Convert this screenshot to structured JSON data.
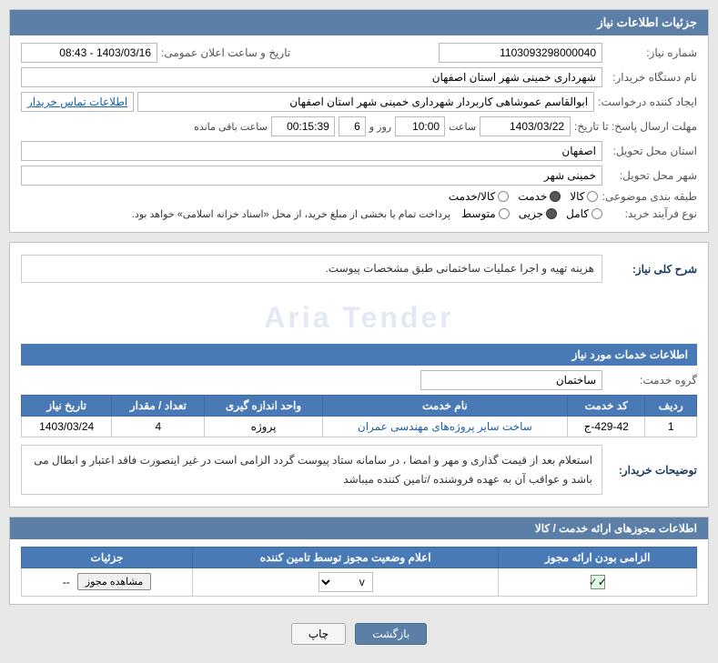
{
  "page": {
    "title": "جزئیات اطلاعات نیاز",
    "sections": {
      "main_info": {
        "header": "جزئیات اطلاعات نیاز",
        "fields": {
          "request_number_label": "شماره نیاز:",
          "request_number_value": "1103093298000040",
          "date_time_label": "تاریخ و ساعت اعلان عمومی:",
          "date_time_value": "1403/03/16 - 08:43",
          "buyer_org_label": "نام دستگاه خریدار:",
          "buyer_org_value": "شهرداری خمینی شهر استان اصفهان",
          "creator_label": "ایجاد کننده درخواست:",
          "creator_value": "ابوالقاسم عموشاهی کاربردار شهرداری خمینی شهر استان اصفهان",
          "contact_link": "اطلاعات تماس خریدار",
          "response_deadline_label": "مهلت ارسال پاسخ: تا تاریخ:",
          "response_date": "1403/03/22",
          "response_time_label": "ساعت",
          "response_time": "10:00",
          "response_day_label": "روز و",
          "response_day": "6",
          "response_remaining_label": "ساعت باقی مانده",
          "response_remaining": "00:15:39",
          "delivery_province_label": "استان محل تحویل:",
          "delivery_province_value": "اصفهان",
          "delivery_city_label": "شهر محل تحویل:",
          "delivery_city_value": "خمینی شهر",
          "category_label": "طبقه بندی موضوعی:",
          "category_goods": "کالا",
          "category_service": "خدمت",
          "category_goods_service": "کالا/خدمت",
          "category_selected": "خدمت",
          "purchase_type_label": "نوع فرآیند خرید:",
          "purchase_full": "کامل",
          "purchase_partial": "جزیی",
          "purchase_medium": "متوسط",
          "purchase_selected": "جزیی",
          "purchase_note": "پرداخت تمام یا بخشی از مبلغ خرید، از محل «اسناد خزانه اسلامی» خواهد بود."
        }
      },
      "description": {
        "header": "شرح کلی نیاز:",
        "value": "هزینه تهیه و اجرا عملیات ساختمانی طبق مشخصات پیوست.",
        "services_header": "اطلاعات خدمات مورد نیاز",
        "service_group_label": "گروه خدمت:",
        "service_group_value": "ساختمان",
        "table": {
          "columns": [
            "ردیف",
            "کد خدمت",
            "نام خدمت",
            "واحد اندازه گیری",
            "تعداد / مقدار",
            "تاریخ نیاز"
          ],
          "rows": [
            {
              "row_num": "1",
              "code": "429-42-ج",
              "name": "ساخت سایر پروژه‌های مهندسی عمران",
              "unit": "پروژه",
              "qty": "4",
              "date": "1403/03/24"
            }
          ]
        }
      },
      "buyer_note": {
        "label": "توضیحات خریدار:",
        "line1": "استعلام بعد از قیمت گذاری و مهر و امضا ، در سامانه ستاد پیوست گردد الزامی است در غیر اینصورت فاقد اعتبار و ابطال می",
        "line2": "باشد و عواقب آن به عهده فروشنده /تامین کننده میباشد"
      },
      "permits": {
        "header": "اطلاعات مجوزهای ارائه خدمت / کالا",
        "table": {
          "columns": [
            "الزامی بودن ارائه مجوز",
            "اعلام وضعیت مجوز توسط تامین کننده",
            "جزئیات"
          ],
          "rows": [
            {
              "required": true,
              "status": "v",
              "details_btn": "مشاهده مجوز",
              "details_value": "--"
            }
          ]
        }
      }
    },
    "buttons": {
      "print": "چاپ",
      "back": "بازگشت"
    }
  }
}
